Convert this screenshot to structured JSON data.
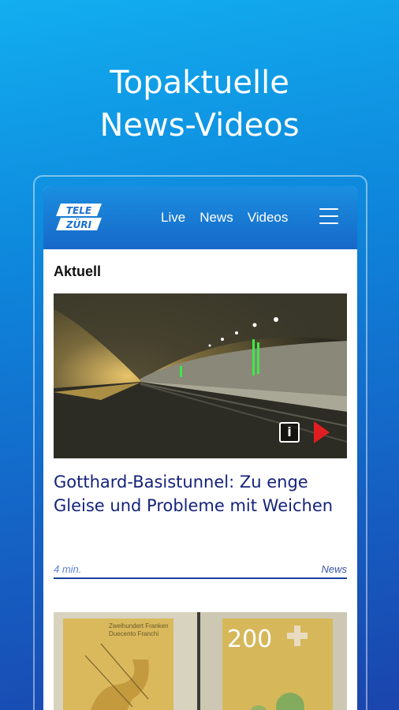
{
  "promo": {
    "line1": "Topaktuelle",
    "line2": "News-Videos"
  },
  "header": {
    "logo_top": "TELE",
    "logo_bottom": "ZÜRI",
    "nav": [
      "Live",
      "News",
      "Videos"
    ]
  },
  "section": {
    "title": "Aktuell"
  },
  "featured": {
    "headline": "Gotthard-Basistunnel: Zu enge Gleise und Probleme mit Weichen",
    "duration": "4 min.",
    "category": "News",
    "info_glyph": "i"
  },
  "second": {
    "banknote_value": "200",
    "banknote_text_1": "Zweihundert Franken",
    "banknote_text_2": "Duecento Franchi"
  },
  "colors": {
    "headline": "#14237a",
    "play": "#e01e22",
    "header_top": "#1a8fe0",
    "header_bottom": "#1768c8"
  }
}
